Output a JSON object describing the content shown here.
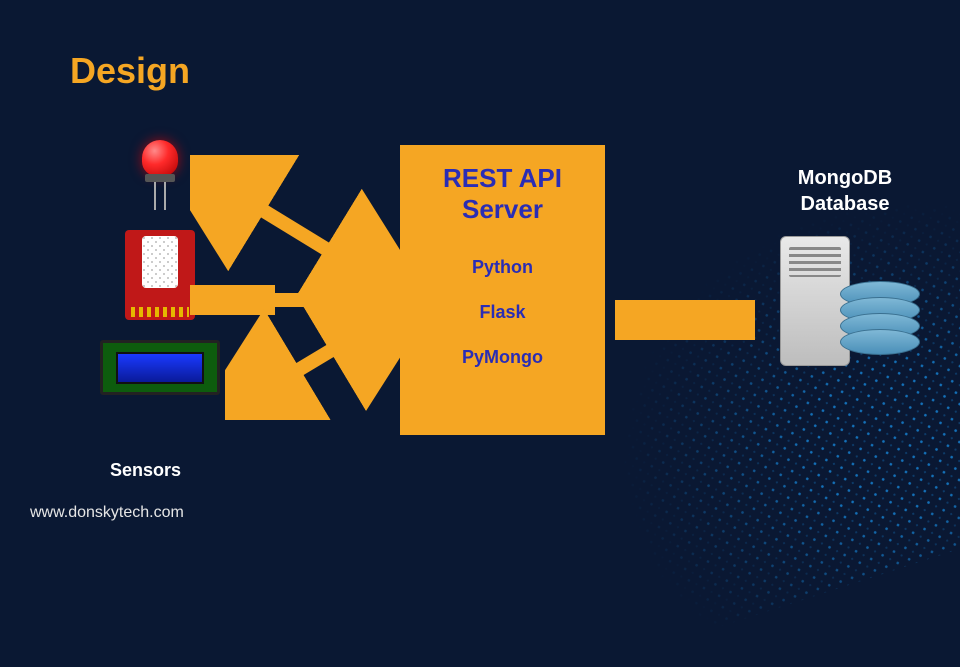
{
  "title": "Design",
  "sensors_label": "Sensors",
  "server": {
    "title_line1": "REST API",
    "title_line2": "Server",
    "items": [
      "Python",
      "Flask",
      "PyMongo"
    ]
  },
  "database": {
    "label_line1": "MongoDB",
    "label_line2": "Database"
  },
  "watermark": "www.donskytech.com",
  "colors": {
    "accent": "#f5a623",
    "server_text": "#2a2db5",
    "bg": "#0a1833"
  }
}
